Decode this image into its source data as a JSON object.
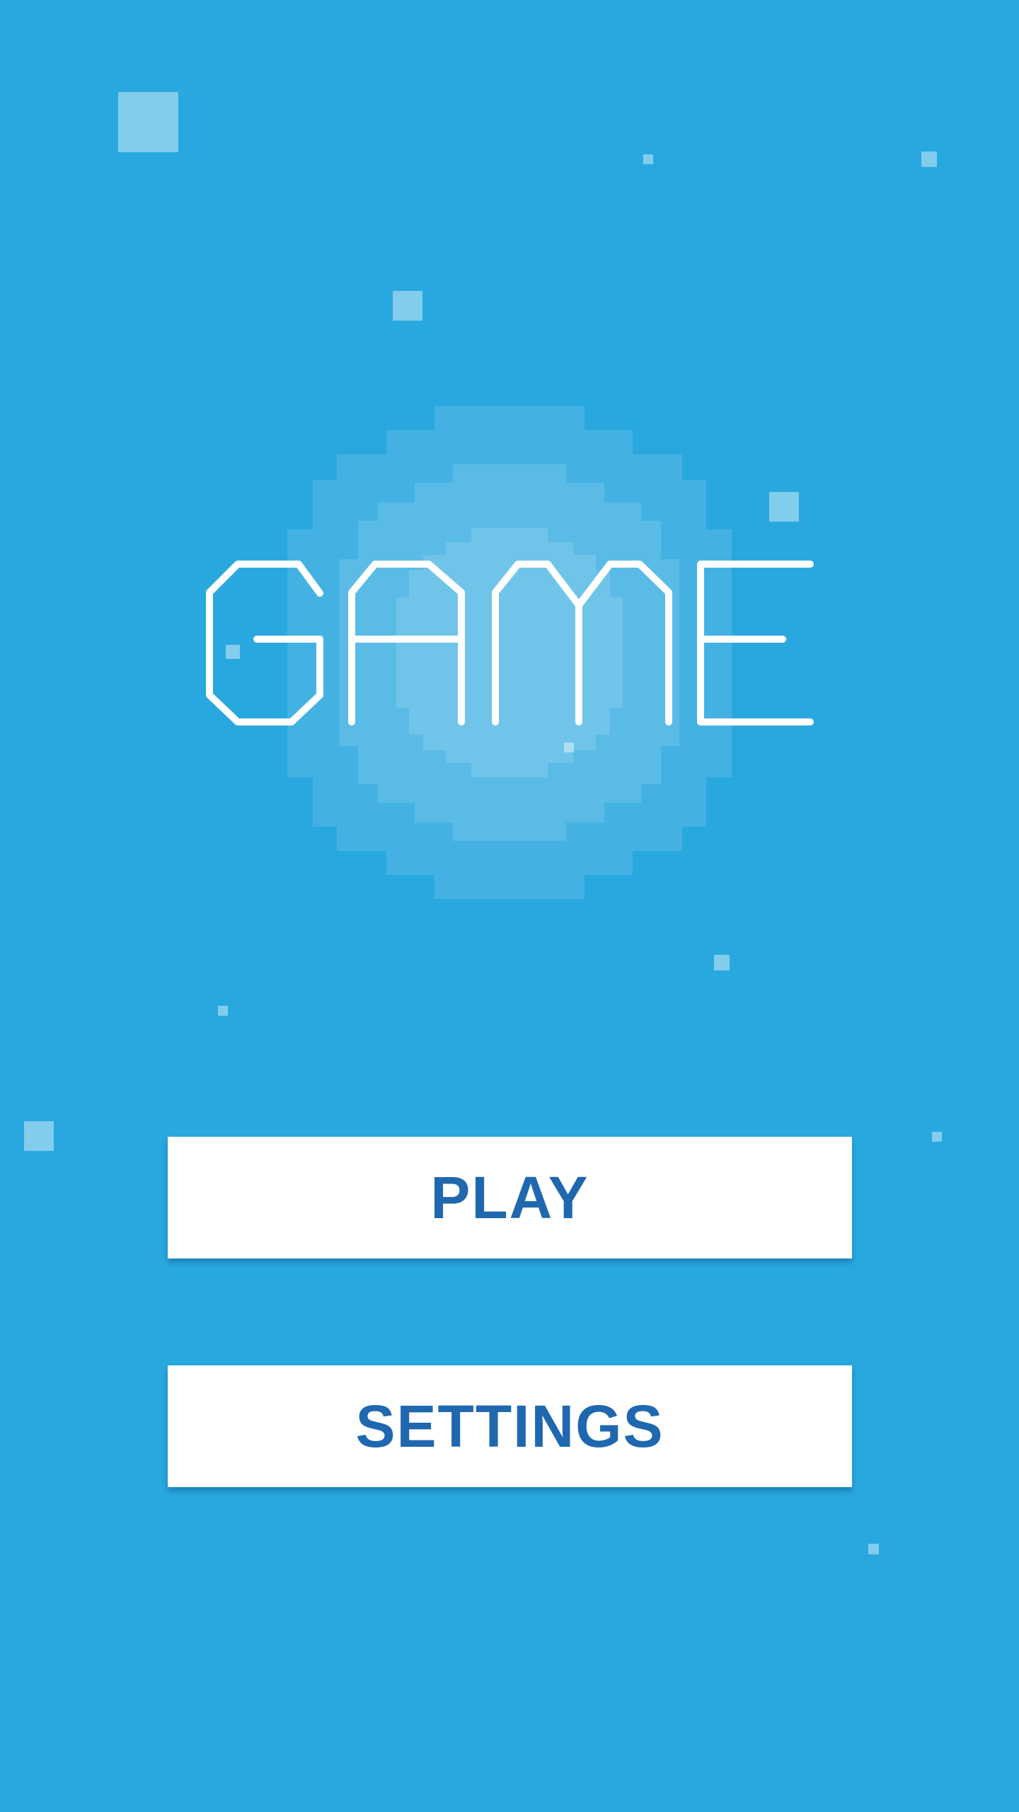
{
  "title": "GAME",
  "menu": {
    "play_label": "PLAY",
    "settings_label": "SETTINGS"
  },
  "colors": {
    "background": "#29a8df",
    "button_background": "#ffffff",
    "button_text": "#1f68b0",
    "logo_stroke": "#ffffff"
  }
}
